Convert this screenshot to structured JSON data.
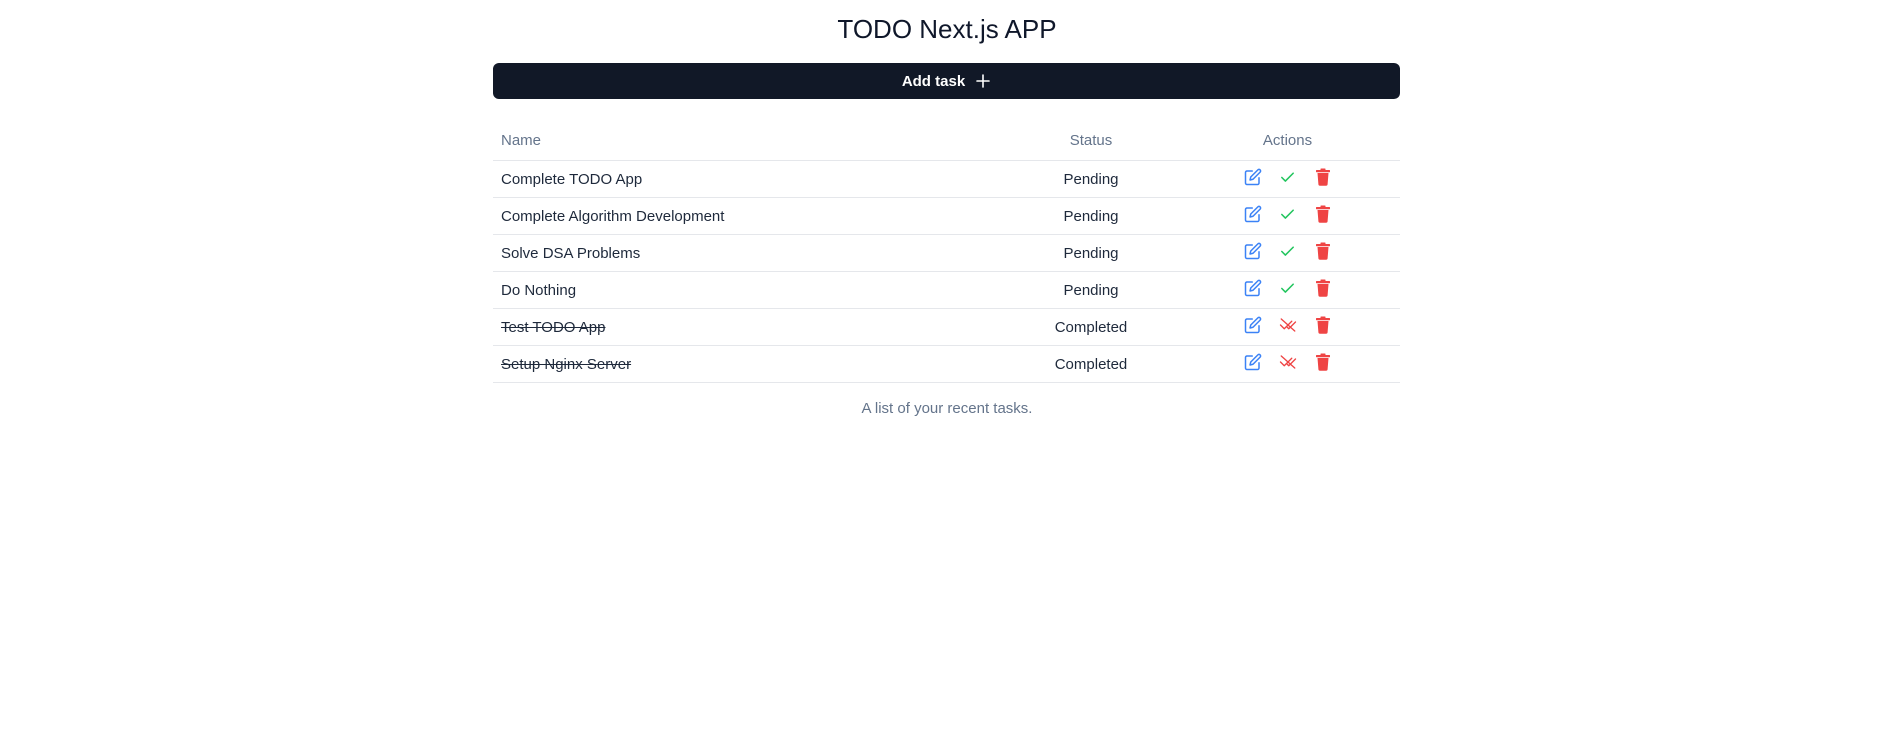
{
  "app": {
    "title": "TODO Next.js APP",
    "add_button_label": "Add task"
  },
  "table": {
    "headers": {
      "name": "Name",
      "status": "Status",
      "actions": "Actions"
    },
    "rows": [
      {
        "name": "Complete TODO App",
        "status": "Pending",
        "completed": false
      },
      {
        "name": "Complete Algorithm Development",
        "status": "Pending",
        "completed": false
      },
      {
        "name": "Solve DSA Problems",
        "status": "Pending",
        "completed": false
      },
      {
        "name": "Do Nothing",
        "status": "Pending",
        "completed": false
      },
      {
        "name": "Test TODO App",
        "status": "Completed",
        "completed": true
      },
      {
        "name": "Setup Nginx Server",
        "status": "Completed",
        "completed": true
      }
    ],
    "caption": "A list of your recent tasks."
  },
  "icons": {
    "add": "plus-icon",
    "edit": "edit-icon",
    "complete": "check-icon",
    "uncomplete": "uncheck-icon",
    "delete": "trash-icon"
  },
  "colors": {
    "button_bg": "#111827",
    "edit": "#3b82f6",
    "complete": "#22c55e",
    "uncomplete": "#ef4444",
    "delete": "#ef4444",
    "muted_text": "#64748b"
  }
}
